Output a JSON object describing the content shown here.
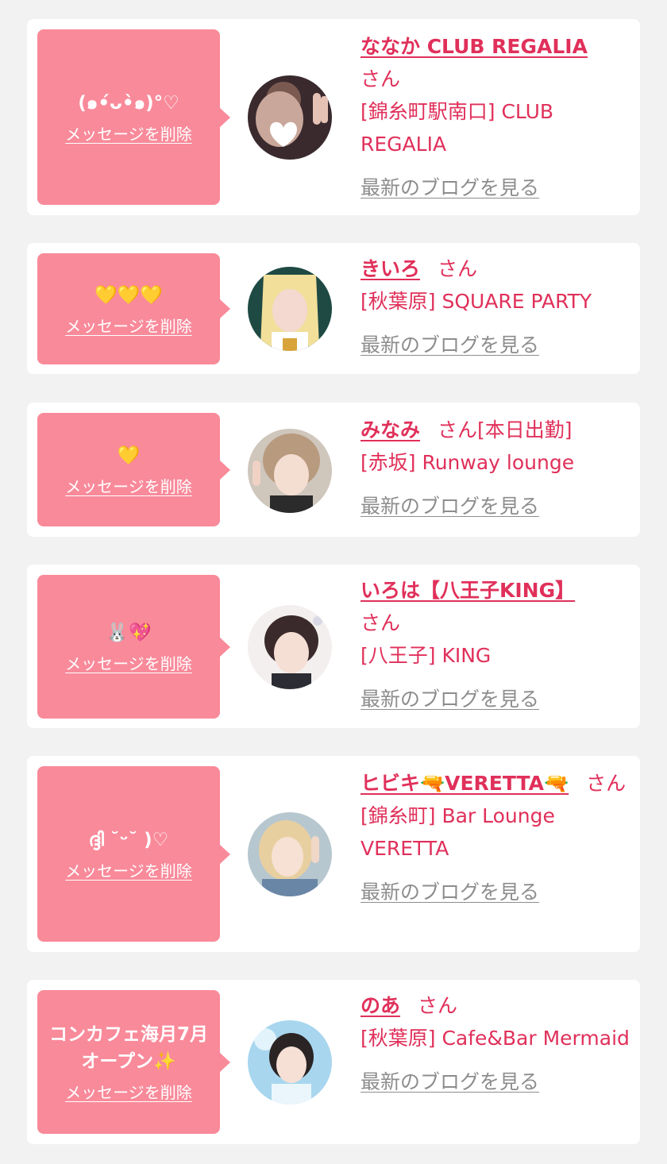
{
  "delete_label": "メッセージを削除",
  "blog_label": "最新のブログを見る",
  "san_label": "さん",
  "entries": [
    {
      "message": "(๑•́ᴗ•̀๑)°♡",
      "name": "ななか CLUB REGALIA",
      "today": "",
      "shop": "[錦糸町駅南口] CLUB REGALIA"
    },
    {
      "message": "💛💛💛",
      "name": "きいろ",
      "today": "",
      "shop": "[秋葉原] SQUARE PARTY"
    },
    {
      "message": "💛",
      "name": "みなみ",
      "today": "[本日出勤]",
      "shop": "[赤坂] Runway lounge"
    },
    {
      "message": "🐰💖",
      "name": "いろは【八王子KING】",
      "today": "",
      "shop": "[八王子] KING"
    },
    {
      "message": "ദ്ദി ˘ᵕ˘ )♡",
      "name": "ヒビキ🔫VERETTA🔫",
      "today": "",
      "shop": "[錦糸町] Bar Lounge VERETTA"
    },
    {
      "message": "コンカフェ海月7月オープン✨",
      "name": "のあ",
      "today": "",
      "shop": "[秋葉原] Cafe&Bar Mermaid"
    }
  ],
  "colors": {
    "background": "#f2f2f2",
    "card": "#ffffff",
    "bubble": "#f98a9a",
    "accent": "#e0305a",
    "link_gray": "#8d8d8d"
  }
}
